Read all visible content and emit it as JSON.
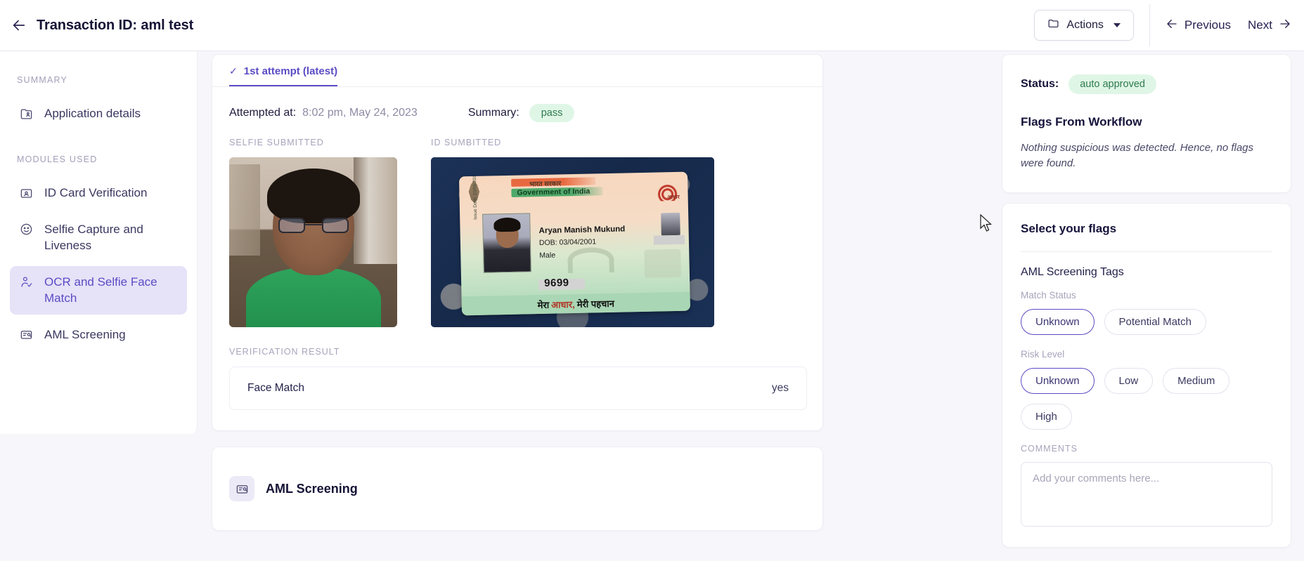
{
  "topbar": {
    "back_icon": "arrow-left-icon",
    "title": "Transaction ID: aml test",
    "actions_label": "Actions",
    "actions_icon": "folder-icon",
    "previous_label": "Previous",
    "next_label": "Next"
  },
  "sidebar": {
    "section_summary": "SUMMARY",
    "section_modules": "MODULES USED",
    "items": [
      {
        "label": "Application details",
        "icon": "contact-card-icon",
        "active": false
      },
      {
        "label": "ID Card Verification",
        "icon": "id-badge-icon",
        "active": false
      },
      {
        "label": "Selfie Capture and Liveness",
        "icon": "smiley-face-icon",
        "active": false
      },
      {
        "label": "OCR and Selfie Face Match",
        "icon": "person-check-icon",
        "active": true
      },
      {
        "label": "AML Screening",
        "icon": "screening-icon",
        "active": false
      }
    ]
  },
  "main": {
    "tab": {
      "label": "1st attempt (latest)",
      "check_glyph": "✓"
    },
    "attempted_at_label": "Attempted at:",
    "attempted_at_value": "8:02 pm, May 24, 2023",
    "summary_label": "Summary:",
    "summary_value": "pass",
    "selfie_label": "SELFIE SUBMITTED",
    "id_label": "ID SUMBITTED",
    "verification_result_label": "VERIFICATION RESULT",
    "result_rows": [
      {
        "key": "Face Match",
        "value": "yes"
      }
    ],
    "bottom_card_title": "AML Screening"
  },
  "id_document": {
    "hindi_gov": "भारत सरकार",
    "gov_line": "Government of India",
    "logo_text": "आधार",
    "issue_date": "Issue Date: 10/08/2013",
    "name": "Aryan Manish Mukund",
    "dob": "DOB: 03/04/2001",
    "sex": "Male",
    "number": "9699",
    "footer_pre": "मेरा",
    "footer_accent": "आधार,",
    "footer_post": "मेरी पहचान"
  },
  "right": {
    "status_label": "Status:",
    "status_value": "auto approved",
    "flags_from_workflow_title": "Flags From Workflow",
    "flags_note": "Nothing suspicious was detected. Hence, no flags were found.",
    "select_flags_title": "Select your flags",
    "aml_tags_title": "AML Screening Tags",
    "match_status_label": "Match Status",
    "match_status_chips": [
      {
        "label": "Unknown",
        "selected": true
      },
      {
        "label": "Potential Match",
        "selected": false
      }
    ],
    "risk_level_label": "Risk Level",
    "risk_level_chips": [
      {
        "label": "Unknown",
        "selected": true
      },
      {
        "label": "Low",
        "selected": false
      },
      {
        "label": "Medium",
        "selected": false
      },
      {
        "label": "High",
        "selected": false
      }
    ],
    "comments_label": "COMMENTS",
    "comments_placeholder": "Add your comments here...",
    "comments_value": ""
  },
  "colors": {
    "accent": "#5b4cc4",
    "accent_bg": "#e6e2f8",
    "success_bg": "#dff6e6",
    "success_text": "#2f7a4e",
    "page_bg": "#f7f7fb"
  }
}
